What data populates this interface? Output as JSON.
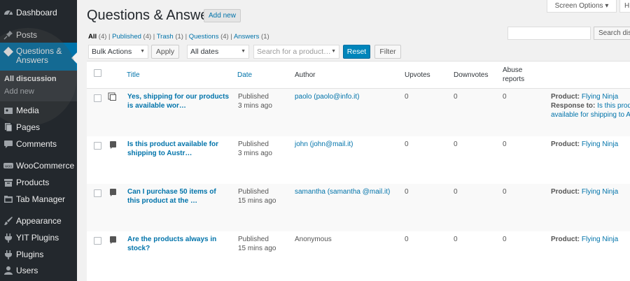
{
  "sidebar": {
    "items": [
      {
        "label": "Dashboard",
        "icon": "dashboard-icon"
      },
      {
        "label": "Posts",
        "icon": "pin-icon"
      },
      {
        "label": "Questions & Answers",
        "icon": "diamond-icon"
      },
      {
        "label": "Media",
        "icon": "media-icon"
      },
      {
        "label": "Pages",
        "icon": "pages-icon"
      },
      {
        "label": "Comments",
        "icon": "comment-icon"
      },
      {
        "label": "WooCommerce",
        "icon": "woocommerce-icon"
      },
      {
        "label": "Products",
        "icon": "archive-icon"
      },
      {
        "label": "Tab Manager",
        "icon": "tab-icon"
      },
      {
        "label": "Appearance",
        "icon": "brush-icon"
      },
      {
        "label": "YIT Plugins",
        "icon": "plugin-icon"
      },
      {
        "label": "Plugins",
        "icon": "plugin-icon"
      },
      {
        "label": "Users",
        "icon": "user-icon"
      }
    ],
    "submenu": {
      "current": "All discussion",
      "add_new": "Add new"
    }
  },
  "header": {
    "title": "Questions & Answers",
    "add_new": "Add new",
    "screen_options": "Screen Options ▾",
    "help": "H"
  },
  "filters": {
    "all": "All",
    "all_count": "(4)",
    "published": "Published",
    "published_count": "(4)",
    "trash": "Trash",
    "trash_count": "(1)",
    "questions": "Questions",
    "questions_count": "(4)",
    "answers": "Answers",
    "answers_count": "(1)"
  },
  "search": {
    "button": "Search disc"
  },
  "toolbar": {
    "bulk_actions": "Bulk Actions",
    "apply": "Apply",
    "dates": "All dates",
    "product_placeholder": "Search for a product…",
    "reset": "Reset",
    "filter": "Filter"
  },
  "table": {
    "columns": {
      "title": "Title",
      "date": "Date",
      "author": "Author",
      "upvotes": "Upvotes",
      "downvotes": "Downvotes",
      "abuse_line1": "Abuse",
      "abuse_line2": "reports"
    },
    "rows": [
      {
        "title_line1": "Yes, shipping for our products",
        "title_line2": "is available wor…",
        "type_icon": "answer-icon",
        "status": "Published",
        "time": "3 mins ago",
        "author": "paolo (paolo@info.it)",
        "upvotes": "0",
        "downvotes": "0",
        "abuse": "0",
        "product_label": "Product:",
        "product": "Flying Ninja",
        "response_label": "Response to:",
        "response_line1": "Is this produ",
        "response_line2": "available for shipping to Au"
      },
      {
        "title_line1": "Is this product available for",
        "title_line2": "shipping to Austr…",
        "type_icon": "question-icon",
        "status": "Published",
        "time": "3 mins ago",
        "author": "john (john@mail.it)",
        "upvotes": "0",
        "downvotes": "0",
        "abuse": "0",
        "product_label": "Product:",
        "product": "Flying Ninja"
      },
      {
        "title_line1": "Can I purchase 50 items of",
        "title_line2": "this product at the …",
        "type_icon": "question-icon",
        "status": "Published",
        "time": "15 mins ago",
        "author": "samantha (samantha @mail.it)",
        "upvotes": "0",
        "downvotes": "0",
        "abuse": "0",
        "product_label": "Product:",
        "product": "Flying Ninja"
      },
      {
        "title_line1": "Are the products always in",
        "title_line2": "stock?",
        "type_icon": "question-icon",
        "status": "Published",
        "time": "15 mins ago",
        "author": "Anonymous",
        "upvotes": "0",
        "downvotes": "0",
        "abuse": "0",
        "product_label": "Product:",
        "product": "Flying Ninja"
      }
    ]
  },
  "colors": {
    "sidebar_bg": "#23282d",
    "accent": "#0073aa",
    "primary_button": "#0085ba"
  }
}
